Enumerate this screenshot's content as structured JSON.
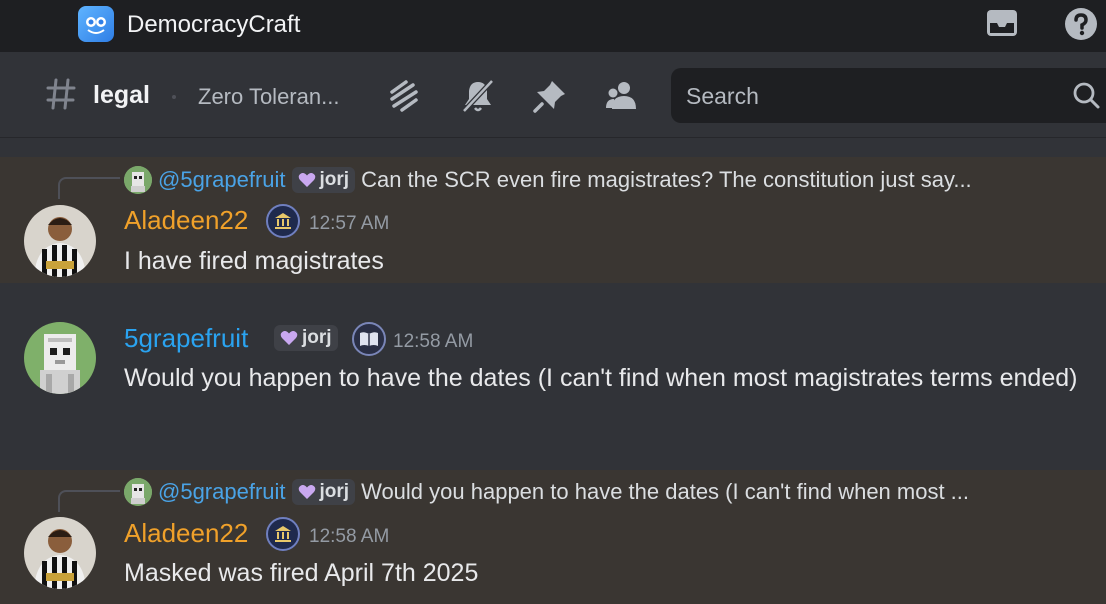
{
  "titlebar": {
    "server_name": "DemocracyCraft",
    "icons": [
      "server-icon",
      "inbox-icon",
      "help-icon"
    ]
  },
  "channel": {
    "name": "legal",
    "topic": "Zero Toleran...",
    "toolbar_icons": [
      "threads-icon",
      "mute-notifications-icon",
      "pin-icon",
      "members-icon"
    ]
  },
  "search": {
    "placeholder": "Search"
  },
  "colors": {
    "background": "#313338",
    "titlebar": "#1e1f22",
    "highlight": "#3a3632",
    "aladeen_name": "#f0a12a",
    "grapefruit_name": "#2aa3f0",
    "reply_mention": "#4aa3e6"
  },
  "messages": [
    {
      "reply": {
        "mention": "@5grapefruit",
        "tag": "jorj",
        "text": "Can the SCR even fire magistrates? The constitution just say..."
      },
      "author": "Aladeen22",
      "timestamp": "12:57 AM",
      "content": "I have fired magistrates"
    },
    {
      "author": "5grapefruit",
      "tag": "jorj",
      "timestamp": "12:58 AM",
      "content": "Would you happen to have the dates (I can't find when most magistrates terms ended)"
    },
    {
      "reply": {
        "mention": "@5grapefruit",
        "tag": "jorj",
        "text": "Would you happen to have the dates (I can't find when most ..."
      },
      "author": "Aladeen22",
      "timestamp": "12:58 AM",
      "content": "Masked was fired April 7th 2025"
    }
  ]
}
